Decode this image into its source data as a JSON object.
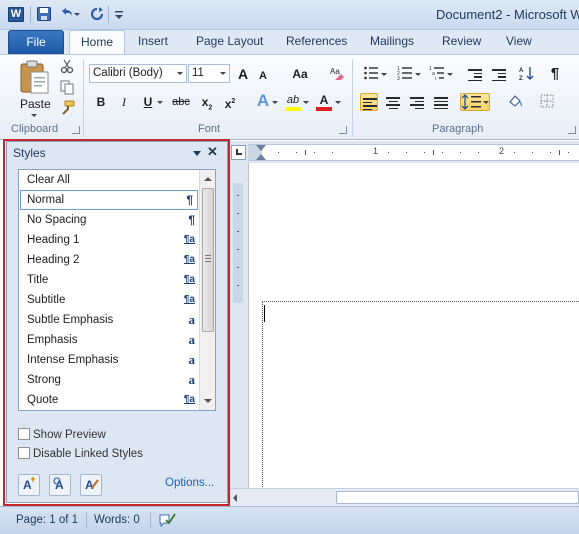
{
  "titlebar": {
    "app_icon": "W",
    "title": "Document2 - Microsoft W",
    "quick_access": [
      "save-icon",
      "undo-icon",
      "redo-icon",
      "customize-icon"
    ]
  },
  "tabs": {
    "file": "File",
    "items": [
      "Home",
      "Insert",
      "Page Layout",
      "References",
      "Mailings",
      "Review",
      "View"
    ],
    "active": "Home"
  },
  "ribbon": {
    "clipboard": {
      "label": "Clipboard",
      "paste": "Paste"
    },
    "font": {
      "label": "Font",
      "family": "Calibri (Body)",
      "size": "11",
      "change_case": "Aa",
      "bold": "B",
      "italic": "I",
      "underline": "U",
      "strikethrough": "abc",
      "subscript": "x",
      "superscript": "x",
      "effects": "A",
      "highlight": "ab",
      "font_color": "A",
      "grow": "A",
      "shrink": "A"
    },
    "paragraph": {
      "label": "Paragraph",
      "show_marks": "¶"
    }
  },
  "styles_pane": {
    "title": "Styles",
    "items": [
      {
        "name": "Clear All",
        "type": ""
      },
      {
        "name": "Normal",
        "type": "¶"
      },
      {
        "name": "No Spacing",
        "type": "¶"
      },
      {
        "name": "Heading 1",
        "type": "¶a"
      },
      {
        "name": "Heading 2",
        "type": "¶a"
      },
      {
        "name": "Title",
        "type": "¶a"
      },
      {
        "name": "Subtitle",
        "type": "¶a"
      },
      {
        "name": "Subtle Emphasis",
        "type": "a"
      },
      {
        "name": "Emphasis",
        "type": "a"
      },
      {
        "name": "Intense Emphasis",
        "type": "a"
      },
      {
        "name": "Strong",
        "type": "a"
      },
      {
        "name": "Quote",
        "type": "¶a"
      }
    ],
    "selected": "Normal",
    "show_preview": "Show Preview",
    "disable_linked": "Disable Linked Styles",
    "show_preview_checked": false,
    "disable_linked_checked": false,
    "options": "Options..."
  },
  "ruler": {
    "numbers": [
      "1",
      "2"
    ]
  },
  "statusbar": {
    "page": "Page: 1 of 1",
    "words": "Words: 0"
  },
  "colors": {
    "accent": "#2b5797",
    "file_tab": "#2a66b4",
    "highlight_frame": "#c4262e"
  }
}
